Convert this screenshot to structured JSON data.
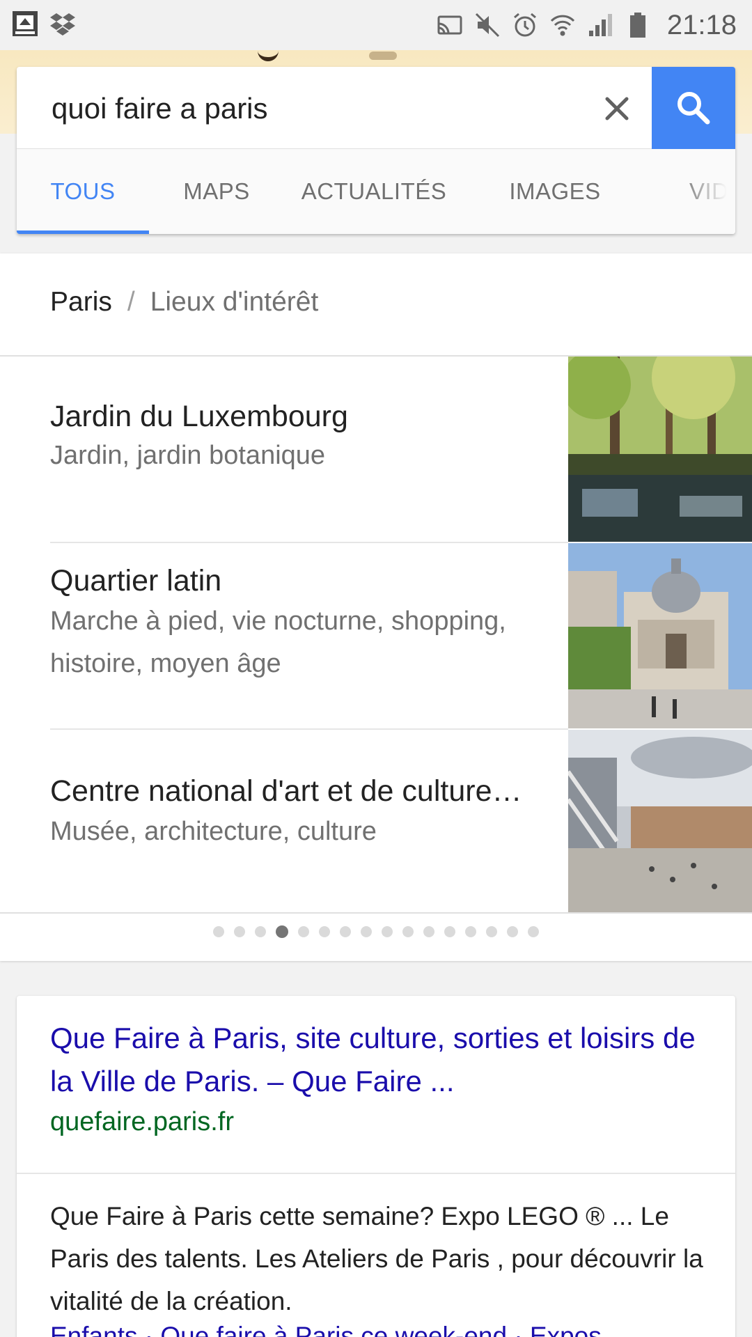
{
  "status_bar": {
    "time": "21:18",
    "left_icons": [
      "app-badge-icon",
      "dropbox-icon"
    ],
    "right_icons": [
      "cast-icon",
      "mute-icon",
      "alarm-icon",
      "wifi-icon",
      "signal-icon",
      "battery-icon"
    ]
  },
  "search": {
    "query": "quoi faire a paris"
  },
  "tabs": [
    {
      "label": "TOUS",
      "active": true
    },
    {
      "label": "MAPS",
      "active": false
    },
    {
      "label": "ACTUALITÉS",
      "active": false
    },
    {
      "label": "IMAGES",
      "active": false
    },
    {
      "label": "VIDÉOS",
      "active": false
    }
  ],
  "poi": {
    "breadcrumb": {
      "city": "Paris",
      "separator": "/",
      "category": "Lieux d'intérêt"
    },
    "items": [
      {
        "name": "Jardin du Luxembourg",
        "description": "Jardin, jardin botanique",
        "image": "luxembourg-garden-photo"
      },
      {
        "name": "Quartier latin",
        "description": "Marche à pied, vie nocturne, shopping, histoire, moyen âge",
        "image": "sorbonne-photo"
      },
      {
        "name": "Centre national d'art et de culture…",
        "description": "Musée, architecture, culture",
        "image": "pompidou-photo"
      }
    ],
    "pagination": {
      "count": 16,
      "active_index": 3
    }
  },
  "result": {
    "title": "Que Faire à Paris, site culture, sorties et loisirs de la Ville de Paris. – Que Faire ...",
    "url": "quefaire.paris.fr",
    "snippet": "Que Faire à Paris cette semaine? Expo LEGO ® ... Le Paris des talents. Les Ateliers de Paris , pour découvrir la vitalité de la création.",
    "sublinks": "Enfants · Que faire à Paris ce week-end · Expos"
  },
  "colors": {
    "accent": "#4285f4",
    "link": "#1a0dab",
    "url": "#006621",
    "text": "#222222",
    "secondary_text": "#707070"
  }
}
